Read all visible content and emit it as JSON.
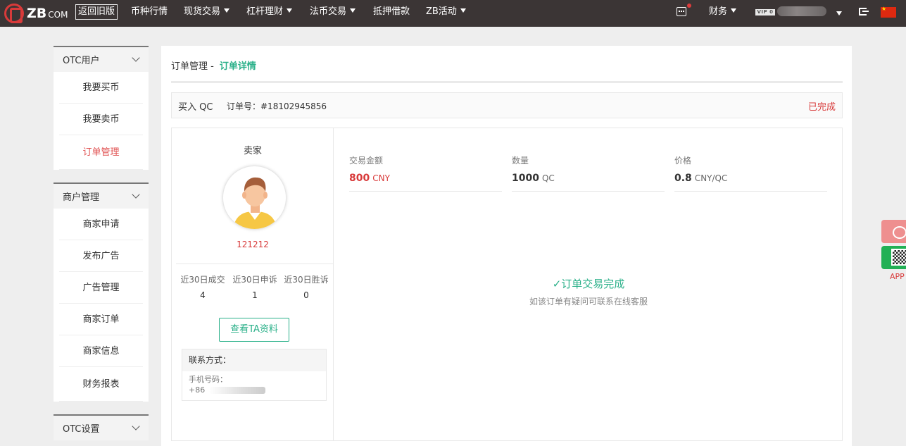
{
  "header": {
    "logo": "ZB",
    "logo_suffix": "COM",
    "old_version": "返回旧版",
    "nav": [
      {
        "label": "币种行情",
        "dropdown": false
      },
      {
        "label": "现货交易",
        "dropdown": true
      },
      {
        "label": "杠杆理财",
        "dropdown": true
      },
      {
        "label": "法币交易",
        "dropdown": true
      },
      {
        "label": "抵押借款",
        "dropdown": false
      },
      {
        "label": "ZB活动",
        "dropdown": true
      }
    ],
    "finance": "财务",
    "vip": "VIP 0",
    "icons": {
      "message": "chat-icon",
      "logout": "logout-icon",
      "language": "china-flag-icon"
    }
  },
  "sidebar": {
    "groups": [
      {
        "title": "OTC用户",
        "items": [
          "我要买币",
          "我要卖币",
          "订单管理"
        ],
        "active": "订单管理"
      },
      {
        "title": "商户管理",
        "items": [
          "商家申请",
          "发布广告",
          "广告管理",
          "商家订单",
          "商家信息",
          "财务报表"
        ]
      },
      {
        "title": "OTC设置",
        "items": []
      }
    ]
  },
  "breadcrumb": {
    "parent": "订单管理 -",
    "current": "订单详情"
  },
  "order": {
    "type": "买入 QC",
    "number": "订单号：#18102945856",
    "status": "已完成"
  },
  "seller": {
    "title": "卖家",
    "name": "121212",
    "stats": [
      {
        "label": "近30日成交",
        "value": "4"
      },
      {
        "label": "近30日申诉",
        "value": "1"
      },
      {
        "label": "近30日胜诉",
        "value": "0"
      }
    ],
    "view_button": "查看TA资料",
    "contact_title": "联系方式：",
    "phone_label": "手机号码：",
    "phone_prefix": "+86"
  },
  "trade": {
    "amount_label": "交易金额",
    "amount_value": "800",
    "amount_unit": "CNY",
    "qty_label": "数量",
    "qty_value": "1000",
    "qty_unit": "QC",
    "price_label": "价格",
    "price_value": "0.8",
    "price_unit": "CNY/QC"
  },
  "result": {
    "title": "✓订单交易完成",
    "subtitle": "如该订单有疑问可联系在线客服"
  },
  "float": {
    "app_label": "APP"
  },
  "colors": {
    "topbar": "#3b3535",
    "accent_green": "#2ab089",
    "accent_red": "#d83a3a"
  }
}
